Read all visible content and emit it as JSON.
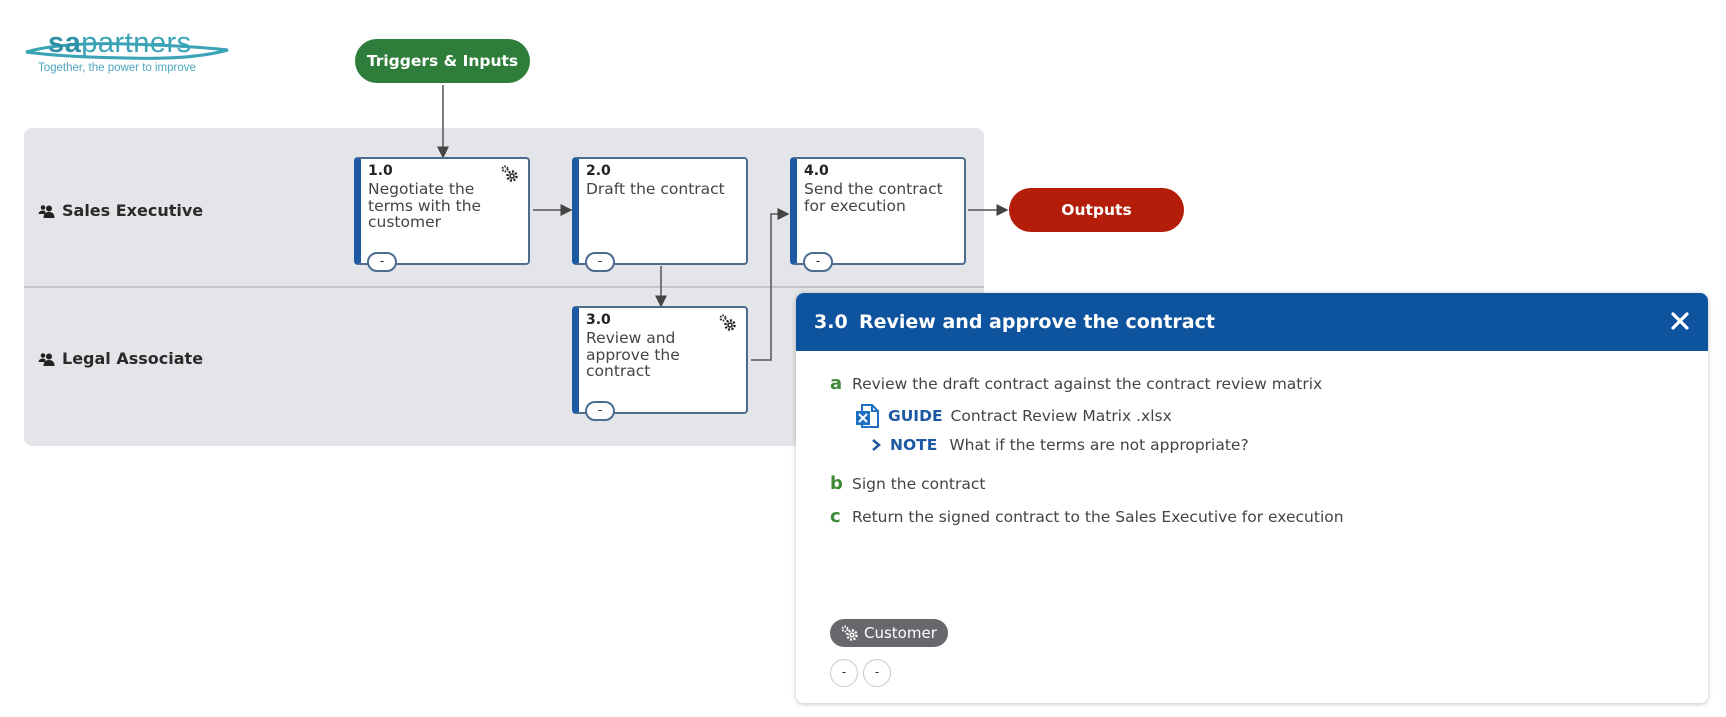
{
  "logo": {
    "brand_bold": "sa",
    "brand_rest": "partners",
    "tagline": "Together, the power to improve"
  },
  "flow": {
    "triggers_label": "Triggers & Inputs",
    "outputs_label": "Outputs",
    "lanes": [
      {
        "label": "Sales Executive",
        "icon": "users-icon"
      },
      {
        "label": "Legal Associate",
        "icon": "users-icon"
      }
    ],
    "steps": [
      {
        "num": "1.0",
        "title": "Negotiate the terms with the customer",
        "has_system": true,
        "toggle": "-"
      },
      {
        "num": "2.0",
        "title": "Draft the contract",
        "has_system": false,
        "toggle": "-"
      },
      {
        "num": "3.0",
        "title": "Review and approve the contract",
        "has_system": true,
        "toggle": "-"
      },
      {
        "num": "4.0",
        "title": "Send the contract for execution",
        "has_system": false,
        "toggle": "-"
      }
    ]
  },
  "panel": {
    "num": "3.0",
    "title": "Review and approve the contract",
    "close_icon": "close-icon",
    "items": [
      {
        "letter": "a",
        "text": "Review the draft contract against the contract review matrix"
      },
      {
        "letter": "b",
        "text": "Sign the contract"
      },
      {
        "letter": "c",
        "text": "Return the signed contract to the Sales Executive for execution"
      }
    ],
    "guide": {
      "kind": "GUIDE",
      "text": "Contract Review Matrix .xlsx",
      "icon": "excel-file-icon"
    },
    "note": {
      "kind": "NOTE",
      "text": "What if the terms are not appropriate?",
      "icon": "chevron-right-icon"
    },
    "system_tag": "Customer",
    "toggles": [
      "-",
      "-"
    ]
  },
  "colors": {
    "triggers": "#2f7d3a",
    "outputs": "#b51d0b",
    "panel_header": "#0d539e",
    "step_accent": "#1d58a3",
    "letter": "#3e8a37"
  }
}
